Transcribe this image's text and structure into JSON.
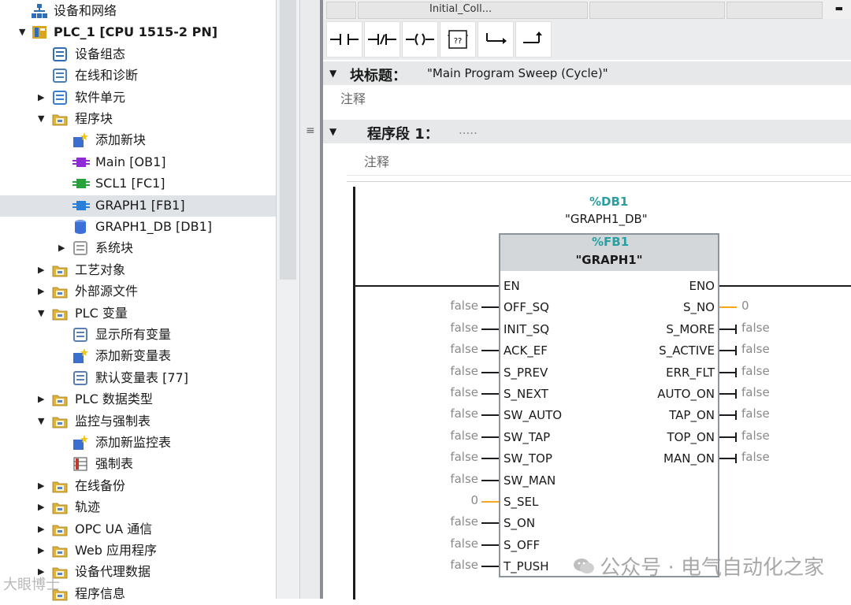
{
  "tree": {
    "items": [
      {
        "label": "设备和网络",
        "icon": "network-icon",
        "indent": 0,
        "arrow": "",
        "bold": false
      },
      {
        "label": "PLC_1 [CPU 1515-2 PN]",
        "icon": "plc-icon",
        "indent": 0,
        "arrow": "down",
        "bold": true
      },
      {
        "label": "设备组态",
        "icon": "device-config-icon",
        "indent": 1,
        "arrow": "",
        "bold": false
      },
      {
        "label": "在线和诊断",
        "icon": "online-diagnostic-icon",
        "indent": 1,
        "arrow": "",
        "bold": false
      },
      {
        "label": "软件单元",
        "icon": "software-unit-icon",
        "indent": 1,
        "arrow": "right",
        "bold": false
      },
      {
        "label": "程序块",
        "icon": "program-blocks-folder-icon",
        "indent": 1,
        "arrow": "down",
        "bold": false
      },
      {
        "label": "添加新块",
        "icon": "add-new-block-icon",
        "indent": 2,
        "arrow": "",
        "bold": false
      },
      {
        "label": "Main [OB1]",
        "icon": "ob-block-icon",
        "indent": 2,
        "arrow": "",
        "bold": false
      },
      {
        "label": "SCL1 [FC1]",
        "icon": "fc-block-icon",
        "indent": 2,
        "arrow": "",
        "bold": false
      },
      {
        "label": "GRAPH1 [FB1]",
        "icon": "fb-block-icon",
        "indent": 2,
        "arrow": "",
        "bold": false,
        "selected": true
      },
      {
        "label": "GRAPH1_DB [DB1]",
        "icon": "db-cylinder-icon",
        "indent": 2,
        "arrow": "",
        "bold": false
      },
      {
        "label": "系统块",
        "icon": "system-blocks-icon",
        "indent": 2,
        "arrow": "right",
        "bold": false
      },
      {
        "label": "工艺对象",
        "icon": "technology-objects-icon",
        "indent": 1,
        "arrow": "right",
        "bold": false
      },
      {
        "label": "外部源文件",
        "icon": "external-sources-icon",
        "indent": 1,
        "arrow": "right",
        "bold": false
      },
      {
        "label": "PLC 变量",
        "icon": "plc-tags-folder-icon",
        "indent": 1,
        "arrow": "down",
        "bold": false
      },
      {
        "label": "显示所有变量",
        "icon": "show-all-tags-icon",
        "indent": 2,
        "arrow": "",
        "bold": false
      },
      {
        "label": "添加新变量表",
        "icon": "add-tag-table-icon",
        "indent": 2,
        "arrow": "",
        "bold": false
      },
      {
        "label": "默认变量表 [77]",
        "icon": "default-tag-table-icon",
        "indent": 2,
        "arrow": "",
        "bold": false
      },
      {
        "label": "PLC 数据类型",
        "icon": "plc-data-types-icon",
        "indent": 1,
        "arrow": "right",
        "bold": false
      },
      {
        "label": "监控与强制表",
        "icon": "watch-force-tables-icon",
        "indent": 1,
        "arrow": "down",
        "bold": false
      },
      {
        "label": "添加新监控表",
        "icon": "add-watch-table-icon",
        "indent": 2,
        "arrow": "",
        "bold": false
      },
      {
        "label": "强制表",
        "icon": "force-table-icon",
        "indent": 2,
        "arrow": "",
        "bold": false
      },
      {
        "label": "在线备份",
        "icon": "online-backup-icon",
        "indent": 1,
        "arrow": "right",
        "bold": false
      },
      {
        "label": "轨迹",
        "icon": "traces-icon",
        "indent": 1,
        "arrow": "right",
        "bold": false
      },
      {
        "label": "OPC UA 通信",
        "icon": "opc-ua-icon",
        "indent": 1,
        "arrow": "right",
        "bold": false
      },
      {
        "label": "Web 应用程序",
        "icon": "web-app-icon",
        "indent": 1,
        "arrow": "right",
        "bold": false
      },
      {
        "label": "设备代理数据",
        "icon": "device-proxy-icon",
        "indent": 1,
        "arrow": "right",
        "bold": false
      },
      {
        "label": "程序信息",
        "icon": "program-info-icon",
        "indent": 1,
        "arrow": "",
        "bold": false
      }
    ]
  },
  "editor": {
    "tabs": [
      "Initial_Coll..."
    ],
    "block_title_label": "块标题：",
    "block_title_value": "\"Main Program Sweep (Cycle)\"",
    "comment_1": "注释",
    "network_label": "程序段 1：",
    "network_dots": ".....",
    "comment_2": "注释"
  },
  "toolbar": {
    "buttons": [
      "no-contact-icon",
      "nc-contact-icon",
      "coil-icon",
      "empty-box-icon",
      "branch-open-icon",
      "branch-close-icon"
    ],
    "empty_box_text": "??"
  },
  "fb": {
    "db_addr": "%DB1",
    "db_name": "\"GRAPH1_DB\"",
    "fb_addr": "%FB1",
    "fb_name": "\"GRAPH1\"",
    "inputs": [
      {
        "name": "EN",
        "value": ""
      },
      {
        "name": "OFF_SQ",
        "value": "false"
      },
      {
        "name": "INIT_SQ",
        "value": "false"
      },
      {
        "name": "ACK_EF",
        "value": "false"
      },
      {
        "name": "S_PREV",
        "value": "false"
      },
      {
        "name": "S_NEXT",
        "value": "false"
      },
      {
        "name": "SW_AUTO",
        "value": "false"
      },
      {
        "name": "SW_TAP",
        "value": "false"
      },
      {
        "name": "SW_TOP",
        "value": "false"
      },
      {
        "name": "SW_MAN",
        "value": "false"
      },
      {
        "name": "S_SEL",
        "value": "0"
      },
      {
        "name": "S_ON",
        "value": "false"
      },
      {
        "name": "S_OFF",
        "value": "false"
      },
      {
        "name": "T_PUSH",
        "value": "false"
      }
    ],
    "outputs": [
      {
        "name": "ENO",
        "value": ""
      },
      {
        "name": "S_NO",
        "value": "0"
      },
      {
        "name": "S_MORE",
        "value": "false"
      },
      {
        "name": "S_ACTIVE",
        "value": "false"
      },
      {
        "name": "ERR_FLT",
        "value": "false"
      },
      {
        "name": "AUTO_ON",
        "value": "false"
      },
      {
        "name": "TAP_ON",
        "value": "false"
      },
      {
        "name": "TOP_ON",
        "value": "false"
      },
      {
        "name": "MAN_ON",
        "value": "false"
      }
    ]
  },
  "watermark": {
    "text": "公众号 · 电气自动化之家",
    "text2": "大眼博士"
  },
  "colors": {
    "db_addr": "#2a9fa0",
    "int_wire": "#f5a623",
    "selected_row": "#dfe3e8",
    "header_bg": "#e6e8ea"
  }
}
